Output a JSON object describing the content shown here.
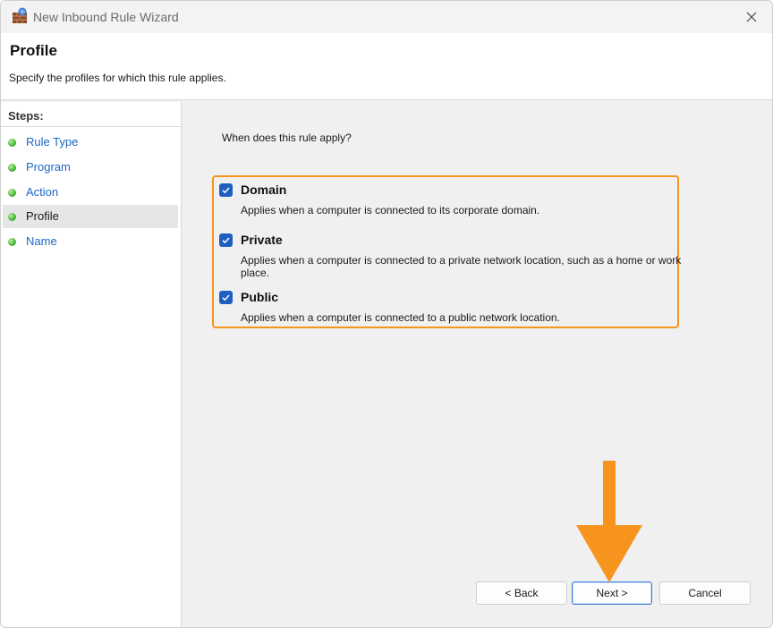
{
  "window": {
    "title": "New Inbound Rule Wizard",
    "icons": {
      "app": "firewall-icon",
      "close": "close-icon"
    }
  },
  "header": {
    "title": "Profile",
    "subtitle": "Specify the profiles for which this rule applies."
  },
  "sidebar": {
    "heading": "Steps:",
    "items": [
      {
        "label": "Rule Type",
        "current": false
      },
      {
        "label": "Program",
        "current": false
      },
      {
        "label": "Action",
        "current": false
      },
      {
        "label": "Profile",
        "current": true
      },
      {
        "label": "Name",
        "current": false
      }
    ]
  },
  "main": {
    "question": "When does this rule apply?",
    "options": [
      {
        "label": "Domain",
        "checked": true,
        "description": "Applies when a computer is connected to its corporate domain."
      },
      {
        "label": "Private",
        "checked": true,
        "description": "Applies when a computer is connected to a private network location, such as a home or work place."
      },
      {
        "label": "Public",
        "checked": true,
        "description": "Applies when a computer is connected to a public network location."
      }
    ]
  },
  "footer": {
    "back_label": "< Back",
    "next_label": "Next >",
    "cancel_label": "Cancel"
  },
  "annotation": {
    "highlight_color": "#f7941d",
    "arrow_color": "#f7941d",
    "arrow_icon": "down-arrow-icon"
  },
  "colors": {
    "accent": "#1d5fc0",
    "link": "#2067c3",
    "step_dot": "#4cbb3c"
  }
}
